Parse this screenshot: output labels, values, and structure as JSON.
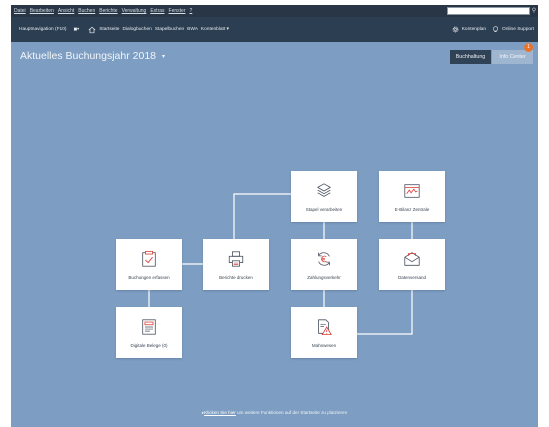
{
  "menubar": {
    "items": [
      "Datei",
      "Bearbeiten",
      "Ansicht",
      "Buchen",
      "Berichte",
      "Verwaltung",
      "Extras",
      "Fenster",
      "?"
    ],
    "search_placeholder": ""
  },
  "navbar": {
    "hauptnavigation": "Hauptnavigation (F10)",
    "links": [
      "Startseite",
      "Dialogbuchen",
      "Stapelbuchen",
      "BWA",
      "Kontenblatt ▾"
    ],
    "right": [
      "Kontenplan",
      "Online Support"
    ]
  },
  "header": {
    "title": "Aktuelles Buchungsjahr",
    "year": "2018"
  },
  "toggles": {
    "buchhaltung": "Buchhaltung",
    "info_center": "Info Center",
    "badge": "1"
  },
  "tiles": {
    "stapel": "Stapel verarbeiten",
    "ebilanz": "E-Bilanz Zentrale",
    "buchungen": "Buchungen erfassen",
    "berichte": "Berichte drucken",
    "zahlung": "Zahlungsverkehr",
    "daten": "Datenversand",
    "belege": "Digitale Belege (0)",
    "mahn": "Mahnwesen"
  },
  "footer": {
    "link": "Klicken Sie hier",
    "rest": " um weitere Funktionen auf der Startseite zu platzieren"
  },
  "colors": {
    "accent": "#d9403a",
    "background": "#7d9ec2",
    "menubar": "#283645",
    "navbar": "#2c3e52",
    "badge": "#e8742c"
  }
}
